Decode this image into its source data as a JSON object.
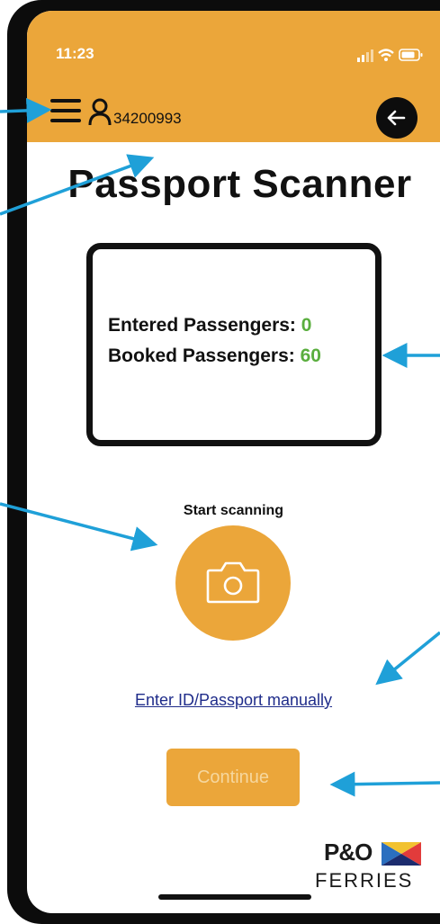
{
  "status_bar": {
    "time": "11:23"
  },
  "header": {
    "user_id": "34200993"
  },
  "page_title": "Passport Scanner",
  "counts": {
    "entered_label": "Entered Passengers: ",
    "entered_value": "0",
    "booked_label": "Booked Passengers: ",
    "booked_value": "60"
  },
  "scan": {
    "label": "Start scanning"
  },
  "manual_link": "Enter ID/Passport manually",
  "continue_label": "Continue",
  "logo": {
    "top": "P&O",
    "bottom": "FERRIES"
  },
  "colors": {
    "accent": "#EBA63A",
    "count_value": "#5AAE3E",
    "link": "#1F2C8A",
    "annotation_arrow": "#1FA0D8"
  },
  "icons": [
    "hamburger-menu-icon",
    "user-icon",
    "back-arrow-icon",
    "camera-icon",
    "wifi-icon",
    "signal-icon",
    "battery-icon",
    "flag-icon"
  ]
}
